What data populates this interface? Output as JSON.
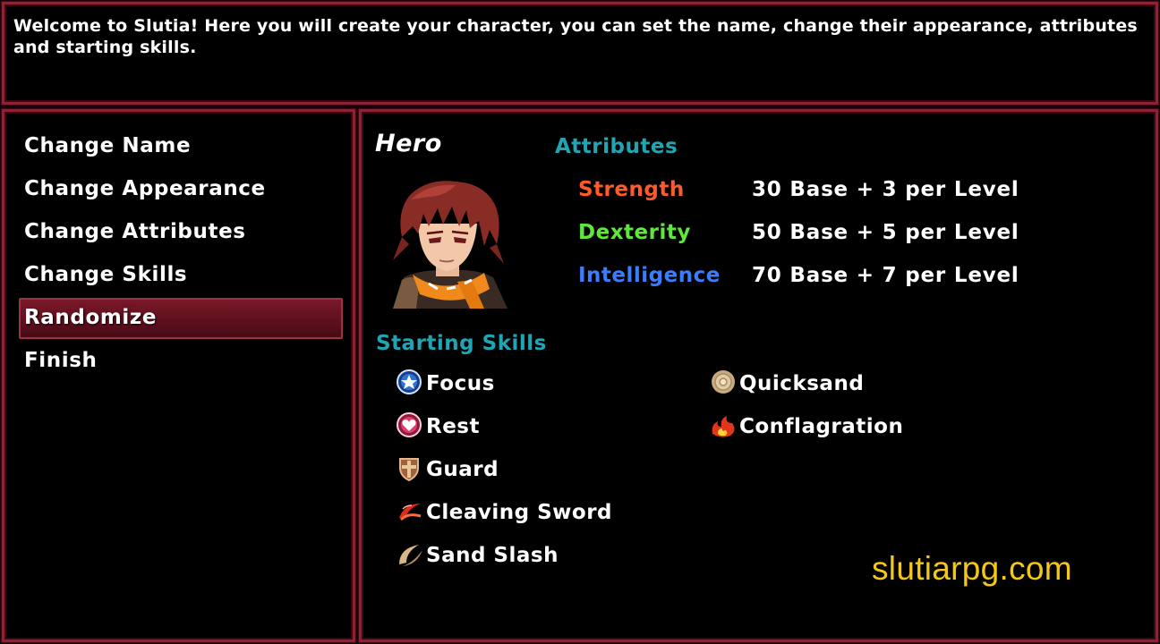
{
  "help": {
    "text": "Welcome to Slutia! Here you will create your character, you can set the name, change their appearance, attributes and starting skills."
  },
  "menu": {
    "items": [
      {
        "label": "Change Name"
      },
      {
        "label": "Change Appearance"
      },
      {
        "label": "Change Attributes"
      },
      {
        "label": "Change Skills"
      },
      {
        "label": "Randomize",
        "selected": true
      },
      {
        "label": "Finish"
      }
    ]
  },
  "status": {
    "hero_name": "Hero",
    "attributes_header": "Attributes",
    "attributes": [
      {
        "name": "Strength",
        "value": "30 Base + 3 per Level",
        "color": "#ff5a2a"
      },
      {
        "name": "Dexterity",
        "value": "50 Base + 5 per Level",
        "color": "#5ee83a"
      },
      {
        "name": "Intelligence",
        "value": "70 Base + 7 per Level",
        "color": "#3a7dff"
      }
    ],
    "skills_header": "Starting Skills",
    "skills_left": [
      {
        "name": "Focus",
        "icon": "star-orb-icon"
      },
      {
        "name": "Rest",
        "icon": "heart-orb-icon"
      },
      {
        "name": "Guard",
        "icon": "shield-icon"
      },
      {
        "name": "Cleaving Sword",
        "icon": "sword-slash-icon"
      },
      {
        "name": "Sand Slash",
        "icon": "sand-slash-icon"
      }
    ],
    "skills_right": [
      {
        "name": "Quicksand",
        "icon": "sand-swirl-icon"
      },
      {
        "name": "Conflagration",
        "icon": "fire-icon"
      }
    ]
  },
  "watermark": "slutiarpg.com",
  "colors": {
    "frame": "#8a2434",
    "system_text": "#1fa5b3",
    "watermark": "#f5c815"
  }
}
